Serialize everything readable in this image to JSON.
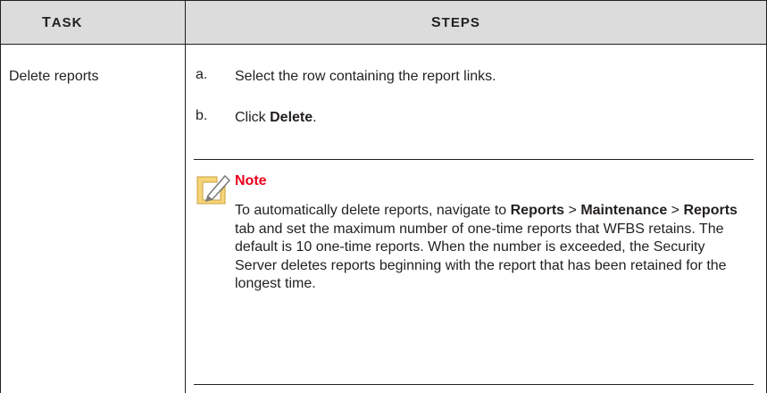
{
  "header": {
    "task_col_first": "T",
    "task_col_rest": "ASK",
    "steps_col_first": "S",
    "steps_col_rest": "TEPS"
  },
  "row": {
    "task": "Delete reports",
    "steps": [
      {
        "letter": "a.",
        "text": "Select the row containing the report links."
      },
      {
        "letter": "b.",
        "text_prefix": "Click ",
        "text_bold": "Delete",
        "text_suffix": "."
      }
    ],
    "note": {
      "title": "Note",
      "icon": "note-pencil-icon",
      "body": {
        "part1": "To automatically delete reports, navigate to ",
        "b1": "Reports",
        "part2": " > ",
        "b2": "Maintenance",
        "part3": " > ",
        "b3": "Reports",
        "part4": " tab and set the maximum number of one-time reports that WFBS retains. The default is 10 one-time reports. When the number is exceeded, the Security Server deletes reports beginning with the report that has been retained for the longest time."
      }
    }
  },
  "colors": {
    "header_bg": "#dcdcdc",
    "note_title": "#e8001c",
    "text": "#231f20"
  }
}
